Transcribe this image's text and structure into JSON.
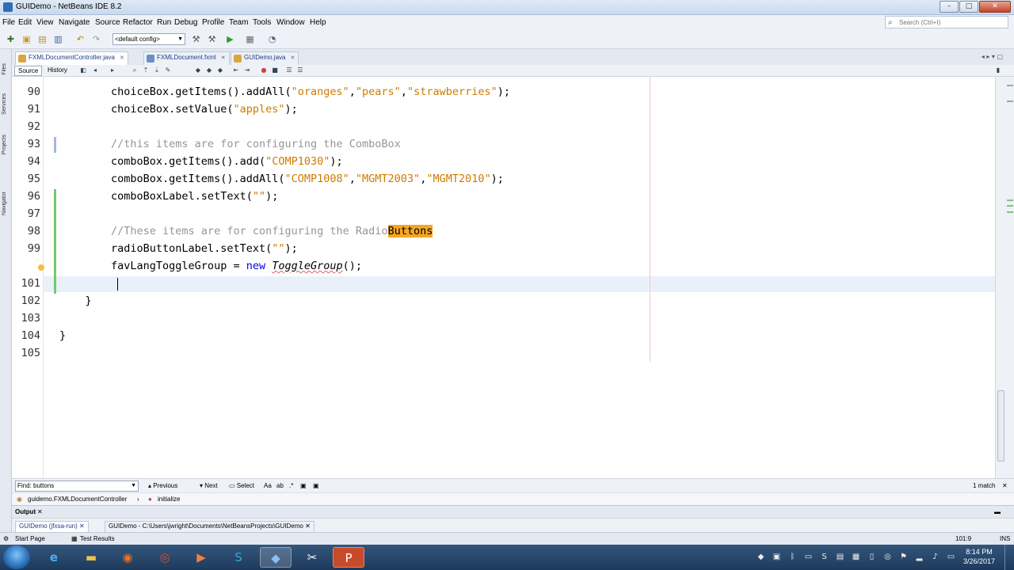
{
  "window": {
    "title": "GUIDemo - NetBeans IDE 8.2"
  },
  "menu": [
    "File",
    "Edit",
    "View",
    "Navigate",
    "Source",
    "Refactor",
    "Run",
    "Debug",
    "Profile",
    "Team",
    "Tools",
    "Window",
    "Help"
  ],
  "search": {
    "placeholder": "Search (Ctrl+I)"
  },
  "toolbar": {
    "config_value": "<default config>"
  },
  "side_panels": [
    "Files",
    "Services",
    "Projects",
    "Navigator"
  ],
  "tabs": [
    {
      "label": "FXMLDocumentController.java",
      "active": true
    },
    {
      "label": "FXMLDocument.fxml",
      "active": false
    },
    {
      "label": "GUIDemo.java",
      "active": false
    }
  ],
  "editor_toolbar": {
    "source_label": "Source",
    "history_label": "History"
  },
  "editor": {
    "lines": [
      {
        "num": "90",
        "code": [
          [
            "plain",
            "        choiceBox.getItems().addAll("
          ],
          [
            "str",
            "\"oranges\""
          ],
          [
            "plain",
            ","
          ],
          [
            "str",
            "\"pears\""
          ],
          [
            "plain",
            ","
          ],
          [
            "str",
            "\"strawberries\""
          ],
          [
            "plain",
            ");"
          ]
        ]
      },
      {
        "num": "91",
        "code": [
          [
            "plain",
            "        choiceBox.setValue("
          ],
          [
            "str",
            "\"apples\""
          ],
          [
            "plain",
            ");"
          ]
        ]
      },
      {
        "num": "92",
        "code": []
      },
      {
        "num": "93",
        "code": [
          [
            "com",
            "        //this items are for configuring the ComboBox"
          ]
        ]
      },
      {
        "num": "94",
        "code": [
          [
            "plain",
            "        comboBox.getItems().add("
          ],
          [
            "str",
            "\"COMP1030\""
          ],
          [
            "plain",
            ");"
          ]
        ]
      },
      {
        "num": "95",
        "code": [
          [
            "plain",
            "        comboBox.getItems().addAll("
          ],
          [
            "str",
            "\"COMP1008\""
          ],
          [
            "plain",
            ","
          ],
          [
            "str",
            "\"MGMT2003\""
          ],
          [
            "plain",
            ","
          ],
          [
            "str",
            "\"MGMT2010\""
          ],
          [
            "plain",
            ");"
          ]
        ]
      },
      {
        "num": "96",
        "code": [
          [
            "plain",
            "        comboBoxLabel.setText("
          ],
          [
            "str",
            "\"\""
          ],
          [
            "plain",
            ");"
          ]
        ]
      },
      {
        "num": "97",
        "code": []
      },
      {
        "num": "98",
        "code": [
          [
            "com",
            "        //These items are for configuring the Radio"
          ],
          [
            "hl",
            "Buttons"
          ]
        ]
      },
      {
        "num": "99",
        "code": [
          [
            "plain",
            "        radioButtonLabel.setText("
          ],
          [
            "str",
            "\"\""
          ],
          [
            "plain",
            ");"
          ]
        ]
      },
      {
        "num": "",
        "code": [
          [
            "plain",
            "        favLangToggleGroup = "
          ],
          [
            "kw",
            "new"
          ],
          [
            "plain",
            " "
          ],
          [
            "it",
            "ToggleGroup"
          ],
          [
            "plain",
            "();"
          ]
        ]
      },
      {
        "num": "101",
        "code": []
      },
      {
        "num": "102",
        "code": [
          [
            "plain",
            "    }"
          ]
        ]
      },
      {
        "num": "103",
        "code": []
      },
      {
        "num": "104",
        "code": [
          [
            "plain",
            "}"
          ]
        ]
      },
      {
        "num": "105",
        "code": []
      }
    ]
  },
  "find": {
    "value": "buttons",
    "label": "Find:",
    "previous": "Previous",
    "next": "Next",
    "select": "Select",
    "matches": "1 match"
  },
  "breadcrumb": {
    "class": "guidemo.FXMLDocumentController",
    "method": "initialize"
  },
  "output": {
    "title": "Output",
    "tabs": [
      "GUIDemo (jfxsa-run)",
      "GUIDemo - C:\\Users\\jwright\\Documents\\NetBeansProjects\\GUIDemo"
    ]
  },
  "status": {
    "start_page": "Start Page",
    "test_results": "Test Results",
    "position": "101:9",
    "mode": "INS"
  },
  "clock": {
    "time": "8:14 PM",
    "date": "3/26/2017"
  }
}
